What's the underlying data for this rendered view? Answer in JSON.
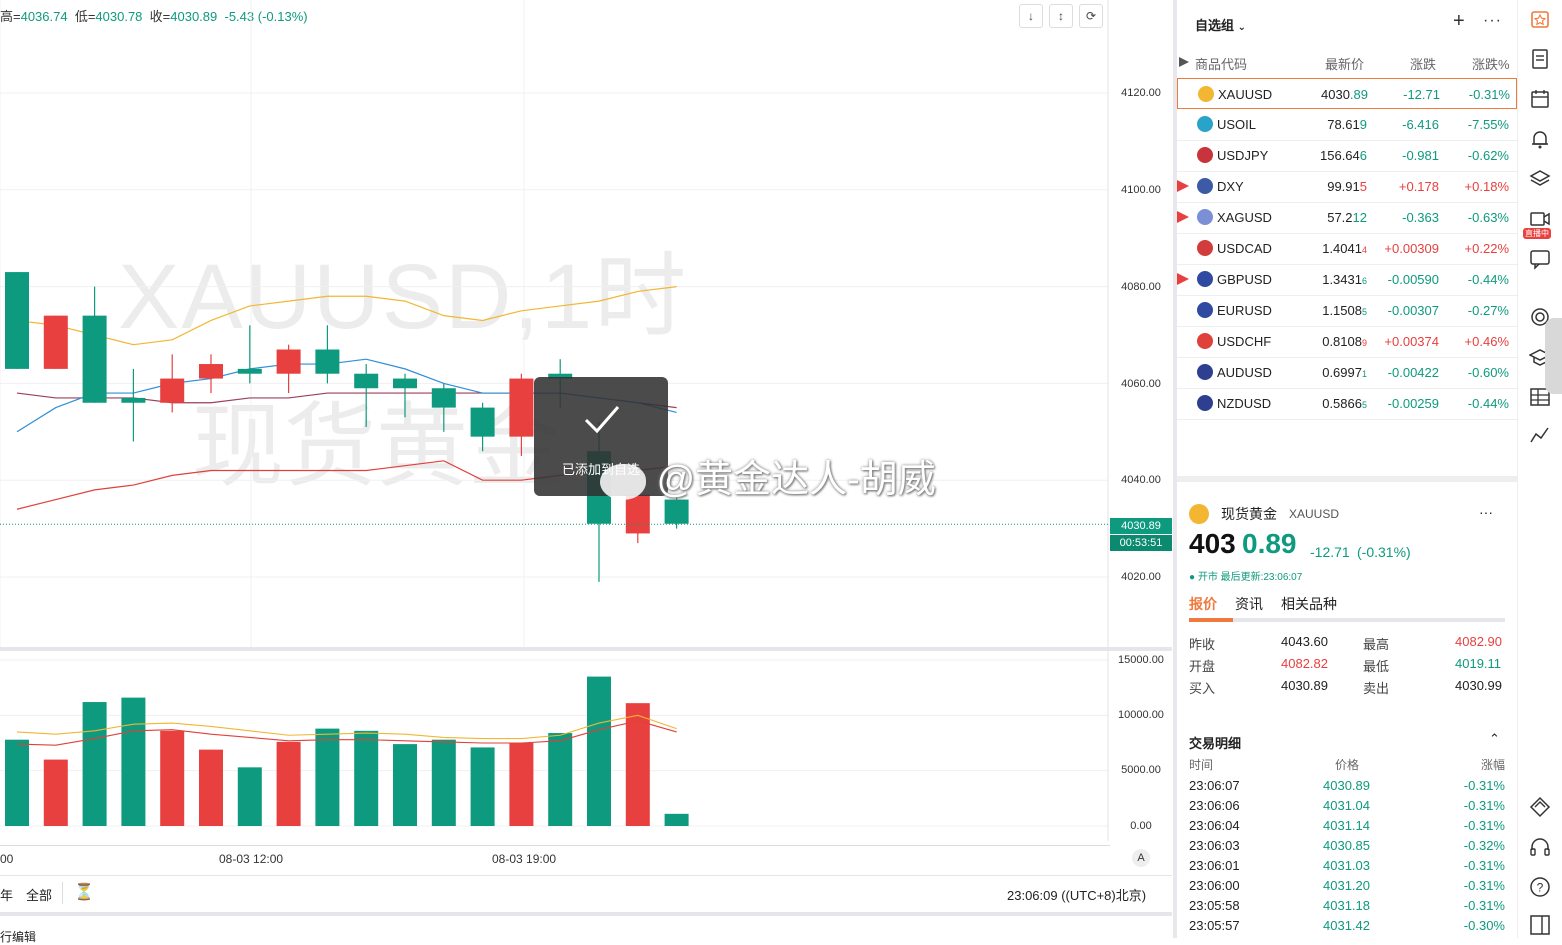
{
  "ohlc": {
    "high_label": "高=",
    "high": "4036.74",
    "low_label": "低=",
    "low": "4030.78",
    "close_label": "收=",
    "close": "4030.89",
    "change": "-5.43",
    "change_pct": "(-0.13%)"
  },
  "price_axis": {
    "ticks": [
      "4120.00",
      "4100.00",
      "4080.00",
      "4060.00",
      "4040.00",
      "4020.00"
    ],
    "current_price": "4030.89",
    "countdown": "00:53:51",
    "volume_ticks": [
      "15000.00",
      "10000.00",
      "5000.00",
      "0.00"
    ],
    "auto_label": "A"
  },
  "watermark": {
    "line1": "XAUUSD,1时",
    "line2": "现货黄金"
  },
  "toast": {
    "message": "已添加到自选"
  },
  "weibo_watermark": "@黄金达人-胡威",
  "time_axis": {
    "labels": [
      "00",
      "08-03 12:00",
      "08-03 19:00"
    ]
  },
  "bottom_bar": {
    "left1": "年",
    "left2": "全部",
    "time": "23:06:09 ((UTC+8)北京)",
    "bottom_partial": "行编辑"
  },
  "watchlist": {
    "title": "自选组",
    "columns": [
      "商品代码",
      "最新价",
      "涨跌",
      "涨跌%"
    ],
    "rows": [
      {
        "symbol": "XAUUSD",
        "last_a": "4030",
        "last_b": ".89",
        "change": "-12.71",
        "pct": "-0.31%",
        "dir": "dn",
        "flag": false,
        "selected": true,
        "icon_color": "#f2b632"
      },
      {
        "symbol": "USOIL",
        "last_a": "78.61",
        "last_b": "9",
        "change": "-6.416",
        "pct": "-7.55%",
        "dir": "dn",
        "flag": false,
        "selected": false,
        "icon_color": "#2aa3c9"
      },
      {
        "symbol": "USDJPY",
        "last_a": "156.64",
        "last_b": "6",
        "change": "-0.981",
        "pct": "-0.62%",
        "dir": "dn",
        "flag": false,
        "selected": false,
        "icon_color": "#c8343c"
      },
      {
        "symbol": "DXY",
        "last_a": "99.91",
        "last_b": "5",
        "change": "+0.178",
        "pct": "+0.18%",
        "dir": "up",
        "flag": true,
        "selected": false,
        "icon_color": "#3c5aa6"
      },
      {
        "symbol": "XAGUSD",
        "last_a": "57.2",
        "last_b": "12",
        "change": "-0.363",
        "pct": "-0.63%",
        "dir": "dn",
        "flag": true,
        "selected": false,
        "icon_color": "#7a8fd6"
      },
      {
        "symbol": "USDCAD",
        "last_a": "1.4041",
        "last_b": "4",
        "change": "+0.00309",
        "pct": "+0.22%",
        "dir": "up",
        "flag": false,
        "selected": false,
        "icon_color": "#d23c3c"
      },
      {
        "symbol": "GBPUSD",
        "last_a": "1.3431",
        "last_b": "6",
        "change": "-0.00590",
        "pct": "-0.44%",
        "dir": "dn",
        "flag": true,
        "selected": false,
        "icon_color": "#2f4aa0"
      },
      {
        "symbol": "EURUSD",
        "last_a": "1.1508",
        "last_b": "5",
        "change": "-0.00307",
        "pct": "-0.27%",
        "dir": "dn",
        "flag": false,
        "selected": false,
        "icon_color": "#2f4aa0"
      },
      {
        "symbol": "USDCHF",
        "last_a": "0.8108",
        "last_b": "9",
        "change": "+0.00374",
        "pct": "+0.46%",
        "dir": "up",
        "flag": false,
        "selected": false,
        "icon_color": "#e0403a"
      },
      {
        "symbol": "AUDUSD",
        "last_a": "0.6997",
        "last_b": "1",
        "change": "-0.00422",
        "pct": "-0.60%",
        "dir": "dn",
        "flag": false,
        "selected": false,
        "icon_color": "#2f3f8f"
      },
      {
        "symbol": "NZDUSD",
        "last_a": "0.5866",
        "last_b": "5",
        "change": "-0.00259",
        "pct": "-0.44%",
        "dir": "dn",
        "flag": false,
        "selected": false,
        "icon_color": "#2f3f8f"
      }
    ]
  },
  "detail": {
    "name": "现货黄金",
    "symbol": "XAUUSD",
    "price_a": "403",
    "price_b": "0.89",
    "change": "-12.71",
    "change_pct": "(-0.31%)",
    "status": "● 开市 最后更新:23:06:07",
    "tabs": [
      "报价",
      "资讯",
      "相关品种"
    ],
    "stats": [
      {
        "k1": "昨收",
        "v1": "4043.60",
        "c1": "",
        "k2": "最高",
        "v2": "4082.90",
        "c2": "up"
      },
      {
        "k1": "开盘",
        "v1": "4082.82",
        "c1": "up",
        "k2": "最低",
        "v2": "4019.11",
        "c2": "dn"
      },
      {
        "k1": "买入",
        "v1": "4030.89",
        "c1": "",
        "k2": "卖出",
        "v2": "4030.99",
        "c2": ""
      }
    ],
    "trades_title": "交易明细",
    "trade_cols": [
      "时间",
      "价格",
      "涨幅"
    ],
    "trades": [
      {
        "t": "23:06:07",
        "p": "4030.89",
        "c": "-0.31%"
      },
      {
        "t": "23:06:06",
        "p": "4031.04",
        "c": "-0.31%"
      },
      {
        "t": "23:06:04",
        "p": "4031.14",
        "c": "-0.31%"
      },
      {
        "t": "23:06:03",
        "p": "4030.85",
        "c": "-0.32%"
      },
      {
        "t": "23:06:01",
        "p": "4031.03",
        "c": "-0.31%"
      },
      {
        "t": "23:06:00",
        "p": "4031.20",
        "c": "-0.31%"
      },
      {
        "t": "23:05:58",
        "p": "4031.18",
        "c": "-0.31%"
      },
      {
        "t": "23:05:57",
        "p": "4031.42",
        "c": "-0.30%"
      }
    ]
  },
  "toolbar": {
    "live_badge": "直播中"
  },
  "colors": {
    "up": "#e8403f",
    "down": "#0e9a7e",
    "accent": "#f07a3d",
    "boll_upper": "#f2b632",
    "ma": "#2d8fd8",
    "ma2": "#9b3f5e",
    "boll_lower": "#e0403a"
  },
  "chart_data": {
    "type": "candlestick",
    "price_range": [
      4000,
      4130
    ],
    "candles": [
      {
        "o": 4063,
        "c": 4083,
        "h": 4083,
        "l": 4063,
        "dir": "up"
      },
      {
        "o": 4074,
        "c": 4063,
        "h": 4074,
        "l": 4063,
        "dir": "dn"
      },
      {
        "o": 4056,
        "c": 4074,
        "h": 4080,
        "l": 4056,
        "dir": "up"
      },
      {
        "o": 4056,
        "c": 4057,
        "h": 4063,
        "l": 4048,
        "dir": "up"
      },
      {
        "o": 4061,
        "c": 4056,
        "h": 4066,
        "l": 4054,
        "dir": "dn"
      },
      {
        "o": 4064,
        "c": 4061,
        "h": 4066,
        "l": 4058,
        "dir": "dn"
      },
      {
        "o": 4062,
        "c": 4063,
        "h": 4072,
        "l": 4060,
        "dir": "up"
      },
      {
        "o": 4067,
        "c": 4062,
        "h": 4068,
        "l": 4058,
        "dir": "dn"
      },
      {
        "o": 4062,
        "c": 4067,
        "h": 4072,
        "l": 4060,
        "dir": "up"
      },
      {
        "o": 4059,
        "c": 4062,
        "h": 4064,
        "l": 4051,
        "dir": "up"
      },
      {
        "o": 4059,
        "c": 4061,
        "h": 4062,
        "l": 4053,
        "dir": "up"
      },
      {
        "o": 4055,
        "c": 4059,
        "h": 4060,
        "l": 4050,
        "dir": "up"
      },
      {
        "o": 4049,
        "c": 4055,
        "h": 4056,
        "l": 4046,
        "dir": "up"
      },
      {
        "o": 4061,
        "c": 4049,
        "h": 4062,
        "l": 4045,
        "dir": "dn"
      },
      {
        "o": 4061,
        "c": 4062,
        "h": 4065,
        "l": 4055,
        "dir": "up"
      },
      {
        "o": 4031,
        "c": 4046,
        "h": 4052,
        "l": 4019,
        "dir": "up"
      },
      {
        "o": 4037,
        "c": 4029,
        "h": 4037,
        "l": 4027,
        "dir": "dn"
      },
      {
        "o": 4031,
        "c": 4036,
        "h": 4037,
        "l": 4030,
        "dir": "up"
      }
    ],
    "volumes": [
      7800,
      6000,
      11200,
      11600,
      8600,
      6900,
      5300,
      7600,
      8800,
      8600,
      7400,
      7800,
      7100,
      7500,
      8400,
      13500,
      11100,
      1100
    ],
    "volume_range": [
      0,
      15000
    ],
    "boll_upper": [
      4073,
      4072,
      4070,
      4068,
      4069,
      4073,
      4076,
      4077,
      4078,
      4078,
      4077,
      4074,
      4073,
      4075,
      4076,
      4077,
      4079,
      4080
    ],
    "ma_fast": [
      4050,
      4055,
      4058,
      4058,
      4060,
      4061,
      4063,
      4064,
      4064,
      4065,
      4063,
      4060,
      4058,
      4058,
      4058,
      4057,
      4056,
      4054
    ],
    "ma_slow": [
      4058,
      4057,
      4057,
      4057,
      4056,
      4056,
      4057,
      4057,
      4058,
      4058,
      4058,
      4058,
      4058,
      4058,
      4058,
      4057,
      4056,
      4055
    ],
    "boll_lower": [
      4034,
      4036,
      4038,
      4039,
      4041,
      4042,
      4042,
      4042,
      4042,
      4042,
      4043,
      4044,
      4040,
      4040,
      4041,
      4042,
      4042,
      4043
    ]
  }
}
